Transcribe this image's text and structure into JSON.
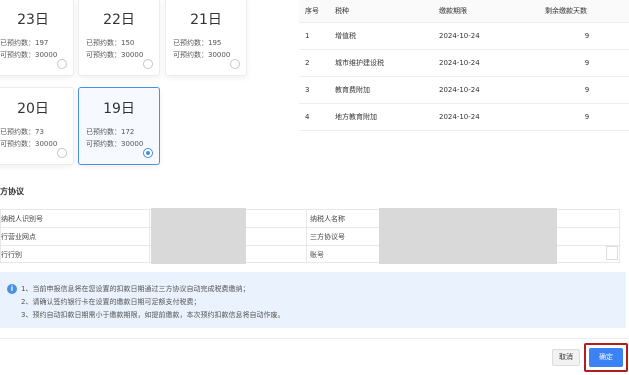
{
  "date_cards": [
    {
      "day": "23日",
      "reserved": "已预约数：197",
      "available": "可预约数：30000",
      "selected": false
    },
    {
      "day": "22日",
      "reserved": "已预约数：150",
      "available": "可预约数：30000",
      "selected": false
    },
    {
      "day": "21日",
      "reserved": "已预约数：195",
      "available": "可预约数：30000",
      "selected": false
    },
    {
      "day": "20日",
      "reserved": "已预约数：73",
      "available": "可预约数：30000",
      "selected": false
    },
    {
      "day": "19日",
      "reserved": "已预约数：172",
      "available": "可预约数：30000",
      "selected": true
    }
  ],
  "tax_table": {
    "headers": [
      "序号",
      "税种",
      "缴款期限",
      "剩余缴款天数"
    ],
    "rows": [
      [
        "1",
        "增值税",
        "2024-10-24",
        "9"
      ],
      [
        "2",
        "城市维护建设税",
        "2024-10-24",
        "9"
      ],
      [
        "3",
        "教育费附加",
        "2024-10-24",
        "9"
      ],
      [
        "4",
        "地方教育附加",
        "2024-10-24",
        "9"
      ]
    ]
  },
  "agreement": {
    "title": "方协议",
    "left_labels": [
      "纳税人识别号",
      "行营业网点",
      "行行别"
    ],
    "right_labels": [
      "纳税人名称",
      "三方协议号",
      "账号"
    ]
  },
  "notice": {
    "icon": "info-icon",
    "lines": [
      "1、当前申报信息将在您设置的扣款日期通过三方协议自动完成税费缴纳；",
      "2、请确认签约银行卡在设置的缴款日期可足额支付税费；",
      "3、预约自动扣款日期需小于缴款期限，如提前缴款，本次预约扣款信息将自动作废。"
    ]
  },
  "buttons": {
    "cancel": "取消",
    "confirm": "确定"
  }
}
